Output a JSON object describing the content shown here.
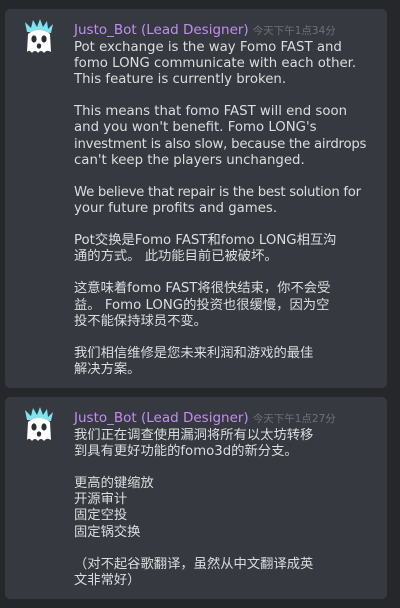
{
  "messages": [
    {
      "author": "Justo_Bot (Lead Designer)",
      "timestamp": "今天下午1点34分",
      "avatar_icon": "ghost-mascot-icon",
      "paragraphs": [
        [
          "Pot exchange is the way Fomo FAST and",
          "fomo LONG communicate with each other.",
          "This feature is currently broken."
        ],
        [
          "This means that fomo FAST will end soon",
          "and you won't benefit. Fomo LONG's",
          "investment is also slow, because the airdrops",
          "can't keep the players unchanged."
        ],
        [
          "We believe that repair is the best solution for",
          "your future profits and games."
        ],
        [
          "Pot交换是Fomo FAST和fomo LONG相互沟",
          "通的方式。 此功能目前已被破坏。"
        ],
        [
          "这意味着fomo FAST将很快结束，你不会受",
          "益。 Fomo LONG的投资也很缓慢，因为空",
          "投不能保持球员不变。"
        ],
        [
          "我们相信维修是您未来利润和游戏的最佳",
          "解决方案。"
        ]
      ]
    },
    {
      "author": "Justo_Bot (Lead Designer)",
      "timestamp": "今天下午1点27分",
      "avatar_icon": "ghost-mascot-icon",
      "paragraphs": [
        [
          "我们正在调查使用漏洞将所有以太坊转移",
          "到具有更好功能的fomo3d的新分支。"
        ],
        [
          "更高的键缩放",
          "开源审计",
          "固定空投",
          "固定锅交换"
        ],
        [
          "（对不起谷歌翻译，虽然从中文翻译成英",
          "文非常好）"
        ]
      ]
    }
  ],
  "colors": {
    "background": "#26272b",
    "card": "#36393f",
    "author": "#c08ff1",
    "timestamp": "#6f7178",
    "text": "#dcddde"
  }
}
